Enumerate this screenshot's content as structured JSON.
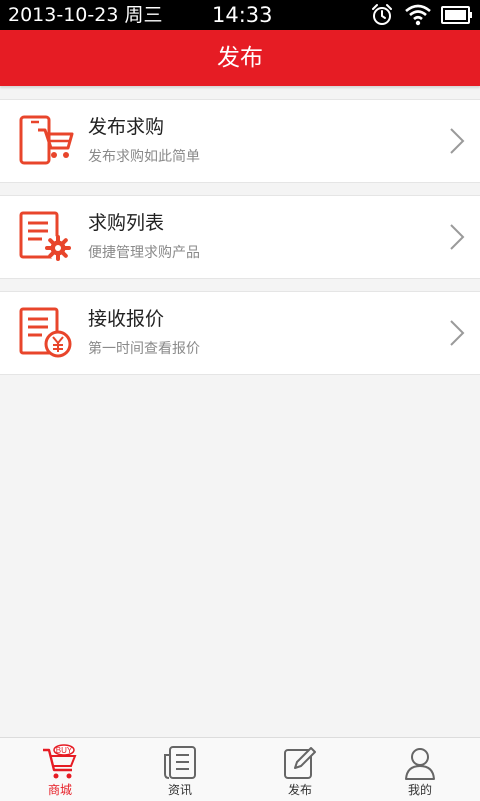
{
  "status_bar": {
    "date": "2013-10-23 周三",
    "time": "14:33",
    "icons": [
      "alarm-icon",
      "wifi-icon",
      "battery-icon"
    ]
  },
  "header": {
    "title": "发布"
  },
  "colors": {
    "accent": "#e61c24",
    "icon_orange": "#e8452b"
  },
  "menu": [
    {
      "title": "发布求购",
      "subtitle": "发布求购如此简单",
      "icon": "tablet-cart-icon"
    },
    {
      "title": "求购列表",
      "subtitle": "便捷管理求购产品",
      "icon": "document-gear-icon"
    },
    {
      "title": "接收报价",
      "subtitle": "第一时间查看报价",
      "icon": "document-yen-icon"
    }
  ],
  "tabs": [
    {
      "label": "商城",
      "icon": "buy-cart-icon",
      "active": true
    },
    {
      "label": "资讯",
      "icon": "news-icon",
      "active": false
    },
    {
      "label": "发布",
      "icon": "edit-icon",
      "active": false
    },
    {
      "label": "我的",
      "icon": "user-icon",
      "active": false
    }
  ]
}
